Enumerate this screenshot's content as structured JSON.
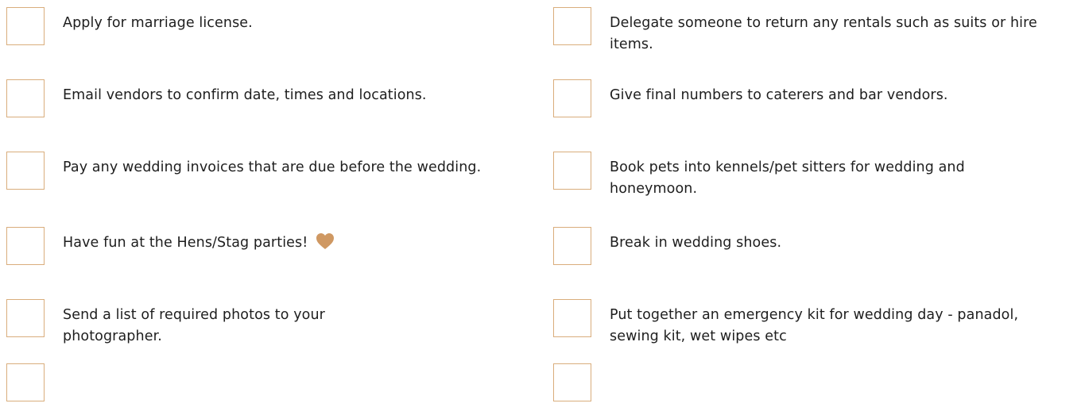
{
  "colors": {
    "checkbox_border": "#d9ad7c",
    "heart": "#cf9862",
    "text": "#1e1e1e"
  },
  "left_items": [
    {
      "label": "Apply for marriage license.",
      "checked": false
    },
    {
      "label": "Email vendors to confirm date, times and locations.",
      "checked": false
    },
    {
      "label": "Pay any wedding invoices that are due before the wedding.",
      "checked": false
    },
    {
      "label": "Have fun at the Hens/Stag parties!",
      "checked": false,
      "icon": "heart-icon"
    },
    {
      "label": "Send a list of required photos to your photographer.",
      "checked": false
    },
    {
      "label": "",
      "checked": false
    }
  ],
  "right_items": [
    {
      "label": "Delegate someone to return any rentals such as suits or hire items.",
      "checked": false
    },
    {
      "label": "Give final numbers to caterers and bar vendors.",
      "checked": false
    },
    {
      "label": "Book pets into kennels/pet sitters for wedding and honeymoon.",
      "checked": false
    },
    {
      "label": "Break in wedding shoes.",
      "checked": false
    },
    {
      "label": "Put together an emergency kit for wedding day - panadol, sewing kit, wet wipes etc",
      "checked": false
    },
    {
      "label": "",
      "checked": false
    }
  ]
}
